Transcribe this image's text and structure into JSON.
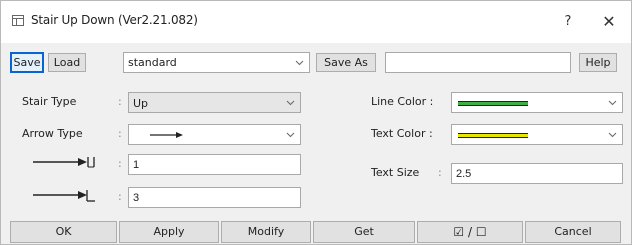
{
  "window": {
    "title": "Stair Up Down (Ver2.21.082)",
    "help_glyph": "?",
    "close_glyph": "✕"
  },
  "toolbar": {
    "save_label": "Save",
    "load_label": "Load",
    "preset_value": "standard",
    "save_as_label": "Save As",
    "save_as_name": "",
    "help_label": "Help"
  },
  "form": {
    "stair_type_label": "Stair Type",
    "stair_type_value": "Up",
    "arrow_type_label": "Arrow Type",
    "arrow_length_value": "1",
    "arrow_head_value": "3",
    "colon": ":",
    "line_color_label": "Line Color :",
    "text_color_label": "Text Color :",
    "text_size_label": "Text Size",
    "text_size_value": "2.5",
    "line_color_swatch": "#3cb043",
    "text_color_swatch": "#e6e600"
  },
  "buttons": {
    "ok": "OK",
    "apply": "Apply",
    "modify": "Modify",
    "get": "Get",
    "toggle": "☑ / ☐",
    "cancel": "Cancel"
  },
  "colors": {
    "accent": "#0a64cf",
    "button_bg": "#e1e1e1",
    "dialog_bg": "#f0f0f0"
  }
}
